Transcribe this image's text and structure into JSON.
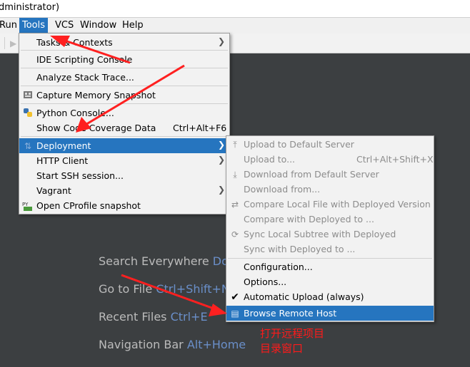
{
  "window": {
    "title_fragment": "dministrator)"
  },
  "menubar": {
    "items": [
      {
        "label": "Run"
      },
      {
        "label": "Tools",
        "active": true
      },
      {
        "label": "VCS"
      },
      {
        "label": "Window"
      },
      {
        "label": "Help"
      }
    ]
  },
  "tools_menu": {
    "items": [
      {
        "label": "Tasks & Contexts",
        "submenu": true
      },
      {
        "label": "IDE Scripting Console"
      },
      {
        "label": "Analyze Stack Trace..."
      },
      {
        "label": "Capture Memory Snapshot",
        "icon": "memory-snapshot-icon"
      },
      {
        "label": "Python Console...",
        "icon": "python-icon"
      },
      {
        "label": "Show Code Coverage Data",
        "shortcut": "Ctrl+Alt+F6"
      },
      {
        "label": "Deployment",
        "submenu": true,
        "selected": true,
        "icon": "deployment-icon"
      },
      {
        "label": "HTTP Client",
        "submenu": true
      },
      {
        "label": "Start SSH session..."
      },
      {
        "label": "Vagrant",
        "submenu": true
      },
      {
        "label": "Open CProfile snapshot",
        "icon": "cprofile-icon"
      }
    ]
  },
  "deployment_menu": {
    "items": [
      {
        "label": "Upload to Default Server",
        "disabled": true,
        "icon": "upload-icon"
      },
      {
        "label": "Upload to...",
        "disabled": true,
        "shortcut": "Ctrl+Alt+Shift+X"
      },
      {
        "label": "Download from Default Server",
        "disabled": true,
        "icon": "download-icon"
      },
      {
        "label": "Download from...",
        "disabled": true
      },
      {
        "label": "Compare Local File with Deployed Version",
        "disabled": true,
        "icon": "compare-icon"
      },
      {
        "label": "Compare with Deployed to ...",
        "disabled": true
      },
      {
        "label": "Sync Local Subtree with Deployed",
        "disabled": true,
        "icon": "sync-icon"
      },
      {
        "label": "Sync with Deployed to ...",
        "disabled": true
      },
      {
        "label": "Configuration..."
      },
      {
        "label": "Options..."
      },
      {
        "label": "Automatic Upload (always)",
        "checked": true
      },
      {
        "label": "Browse Remote Host",
        "selected": true,
        "icon": "browse-remote-host-icon"
      }
    ]
  },
  "welcome_hints": [
    {
      "text": "Search Everywhere ",
      "shortcut": "Dou"
    },
    {
      "text": "Go to File ",
      "shortcut": "Ctrl+Shift+N"
    },
    {
      "text": "Recent Files ",
      "shortcut": "Ctrl+E"
    },
    {
      "text": "Navigation Bar ",
      "shortcut": "Alt+Home"
    }
  ],
  "annotation": {
    "line1": "打开远程项目",
    "line2": "目录窗口",
    "color": "#ff1a1a"
  },
  "colors": {
    "accent": "#2675bf",
    "menu_bg": "#f2f2f2",
    "ide_bg": "#3c3f41"
  }
}
